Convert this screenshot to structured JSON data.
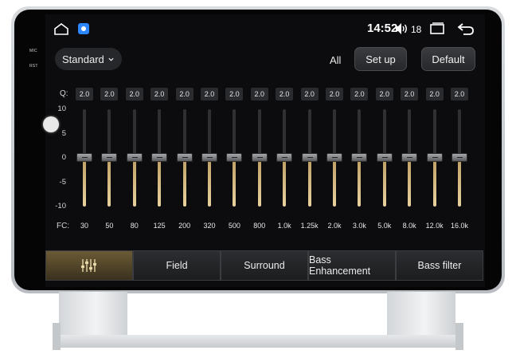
{
  "hardware": {
    "mic_label": "MIC",
    "rst_label": "RST"
  },
  "status_bar": {
    "time": "14:52",
    "volume": "18"
  },
  "toolbar": {
    "preset": "Standard",
    "all_label": "All",
    "setup_label": "Set up",
    "default_label": "Default"
  },
  "equalizer": {
    "q_label": "Q:",
    "fc_label": "FC:",
    "db_ticks": [
      "10",
      "5",
      "0",
      "-5",
      "-10"
    ],
    "q_values": [
      "2.0",
      "2.0",
      "2.0",
      "2.0",
      "2.0",
      "2.0",
      "2.0",
      "2.0",
      "2.0",
      "2.0",
      "2.0",
      "2.0",
      "2.0",
      "2.0",
      "2.0",
      "2.0"
    ],
    "frequencies": [
      "30",
      "50",
      "80",
      "125",
      "200",
      "320",
      "500",
      "800",
      "1.0k",
      "1.25k",
      "2.0k",
      "3.0k",
      "5.0k",
      "8.0k",
      "12.0k",
      "16.0k"
    ],
    "gains_db": [
      0,
      0,
      0,
      0,
      0,
      0,
      0,
      0,
      0,
      0,
      0,
      0,
      0,
      0,
      0,
      0
    ],
    "range_db": [
      -10,
      10
    ]
  },
  "tabs": [
    {
      "label": "",
      "icon": "equalizer-sliders-icon",
      "active": true
    },
    {
      "label": "Field",
      "active": false
    },
    {
      "label": "Surround",
      "active": false
    },
    {
      "label": "Bass Enhancement",
      "active": false
    },
    {
      "label": "Bass filter",
      "active": false
    }
  ],
  "colors": {
    "active_tab": "#6b5a35",
    "slider_fill": "#e9d29e"
  }
}
